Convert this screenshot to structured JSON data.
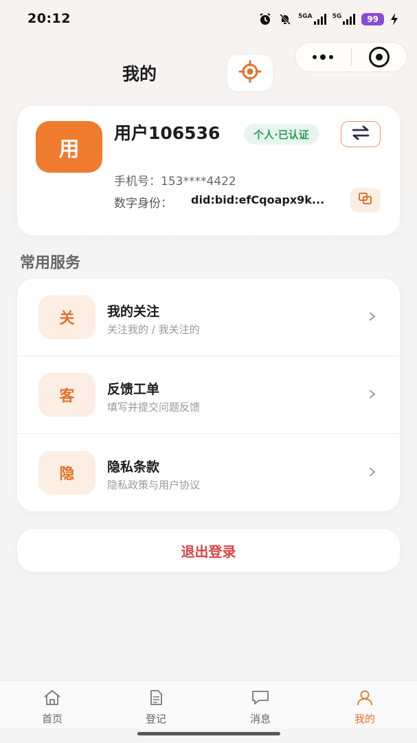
{
  "status_bar": {
    "time": "20:12",
    "signal_1_label": "5GA",
    "signal_2_label": "5G",
    "battery": "99",
    "icons": [
      "alarm-icon",
      "mute-bell-icon",
      "signal-icon",
      "signal-icon",
      "battery-icon",
      "charging-icon"
    ]
  },
  "header": {
    "title": "我的",
    "icons": [
      "locate-icon",
      "more-dots-icon",
      "close-target-icon"
    ]
  },
  "profile": {
    "avatar_text": "用",
    "username": "用户106536",
    "badge": "个人·已认证",
    "phone_label": "手机号：",
    "phone_value": "153****4422",
    "did_label": "数字身份：",
    "did_value": "did:bid:efCqoapx9k...",
    "icons": [
      "switch-arrows-icon",
      "copy-icon"
    ],
    "colors": {
      "accent": "#ef7b2e",
      "badge_bg": "#e7f5ee",
      "badge_text": "#2d9a5c"
    }
  },
  "services": {
    "section_title": "常用服务",
    "items": [
      {
        "icon_text": "关",
        "title": "我的关注",
        "subtitle": "关注我的 / 我关注的"
      },
      {
        "icon_text": "客",
        "title": "反馈工单",
        "subtitle": "填写并提交问题反馈"
      },
      {
        "icon_text": "隐",
        "title": "隐私条款",
        "subtitle": "隐私政策与用户协议"
      }
    ]
  },
  "logout": {
    "label": "退出登录",
    "color": "#d64545"
  },
  "tabbar": {
    "active_color": "#e3722b",
    "items": [
      {
        "label": "首页",
        "icon": "home-icon",
        "active": false
      },
      {
        "label": "登记",
        "icon": "document-icon",
        "active": false
      },
      {
        "label": "消息",
        "icon": "message-icon",
        "active": false
      },
      {
        "label": "我的",
        "icon": "user-icon",
        "active": true
      }
    ]
  }
}
